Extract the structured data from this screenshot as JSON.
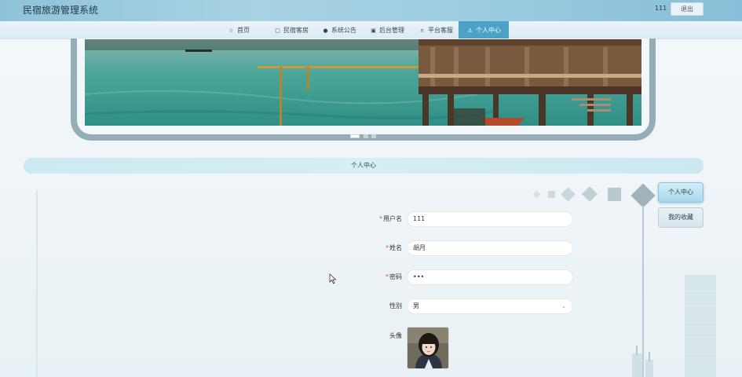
{
  "header": {
    "app_title": "民宿旅游管理系统",
    "username": "111",
    "logout_label": "退出"
  },
  "nav": {
    "items": [
      {
        "label": "首页",
        "icon": "star-icon"
      },
      {
        "label": "民宿客房",
        "icon": "bag-icon"
      },
      {
        "label": "系统公告",
        "icon": "info-icon"
      },
      {
        "label": "后台管理",
        "icon": "briefcase-icon"
      },
      {
        "label": "平台客服",
        "icon": "headset-icon"
      },
      {
        "label": "个人中心",
        "icon": "user-icon"
      }
    ],
    "active_index": 5
  },
  "banner": {
    "slide_count": 3,
    "active_slide": 1
  },
  "section": {
    "title": "个人中心"
  },
  "sidebar": {
    "items": [
      {
        "label": "个人中心",
        "active": true
      },
      {
        "label": "我的收藏",
        "active": false
      }
    ]
  },
  "form": {
    "username": {
      "label": "用户名",
      "required": true,
      "value": "111"
    },
    "name": {
      "label": "姓名",
      "required": true,
      "value": "胡月"
    },
    "password": {
      "label": "密码",
      "required": true,
      "value": "•••"
    },
    "gender": {
      "label": "性别",
      "required": false,
      "value": "男"
    },
    "avatar": {
      "label": "头像",
      "required": false
    }
  },
  "colors": {
    "accent": "#4aa3c7",
    "required_mark": "#e0554f"
  }
}
